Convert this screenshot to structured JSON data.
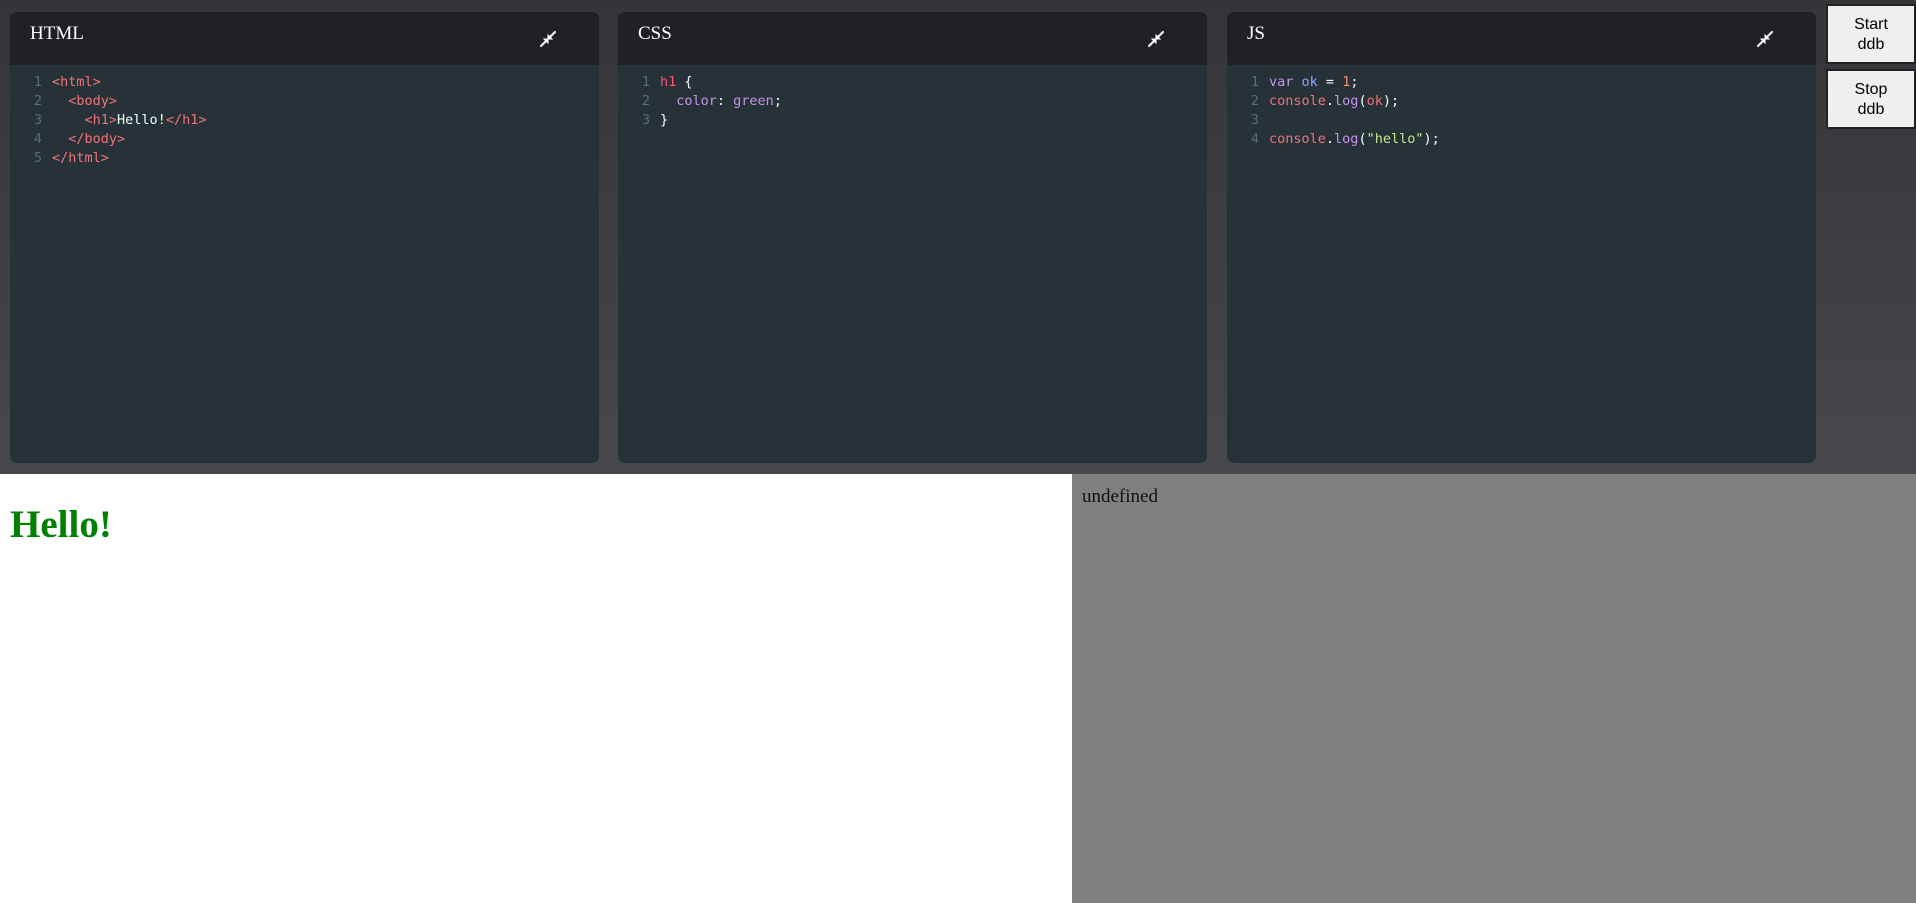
{
  "panels": {
    "html": {
      "title": "HTML",
      "collapse_icon": "collapse-arrows-icon"
    },
    "css": {
      "title": "CSS",
      "collapse_icon": "collapse-arrows-icon"
    },
    "js": {
      "title": "JS",
      "collapse_icon": "collapse-arrows-icon"
    }
  },
  "code": {
    "html": {
      "line_numbers": [
        "1",
        "2",
        "3",
        "4",
        "5"
      ],
      "l1": "<html>",
      "l2": "<body>",
      "l3_open": "<h1>",
      "l3_text": "Hello!",
      "l3_close": "</h1>",
      "l4": "</body>",
      "l5": "</html>"
    },
    "css": {
      "line_numbers": [
        "1",
        "2",
        "3"
      ],
      "l1_selector": "h1",
      "l1_brace": " {",
      "l2_prop": "color",
      "l2_colon": ": ",
      "l2_value": "green",
      "l2_semi": ";",
      "l3": "}"
    },
    "js": {
      "line_numbers": [
        "1",
        "2",
        "3",
        "4"
      ],
      "l1_kw": "var",
      "l1_var": "ok",
      "l1_eq": " = ",
      "l1_num": "1",
      "l1_semi": ";",
      "l2_obj": "console",
      "l2_dot": ".",
      "l2_fn": "log",
      "l2_open": "(",
      "l2_arg": "ok",
      "l2_close": ");",
      "l4_obj": "console",
      "l4_dot": ".",
      "l4_fn": "log",
      "l4_open": "(",
      "l4_str": "\"hello\"",
      "l4_close": ");"
    }
  },
  "buttons": {
    "start_line1": "Start",
    "start_line2": "ddb",
    "stop_line1": "Stop",
    "stop_line2": "ddb"
  },
  "preview": {
    "heading": "Hello!",
    "heading_color": "#008000"
  },
  "console": {
    "output": "undefined"
  },
  "colors": {
    "editor_bg": "#263238",
    "header_bg": "#1f2124",
    "console_bg": "#808080"
  }
}
